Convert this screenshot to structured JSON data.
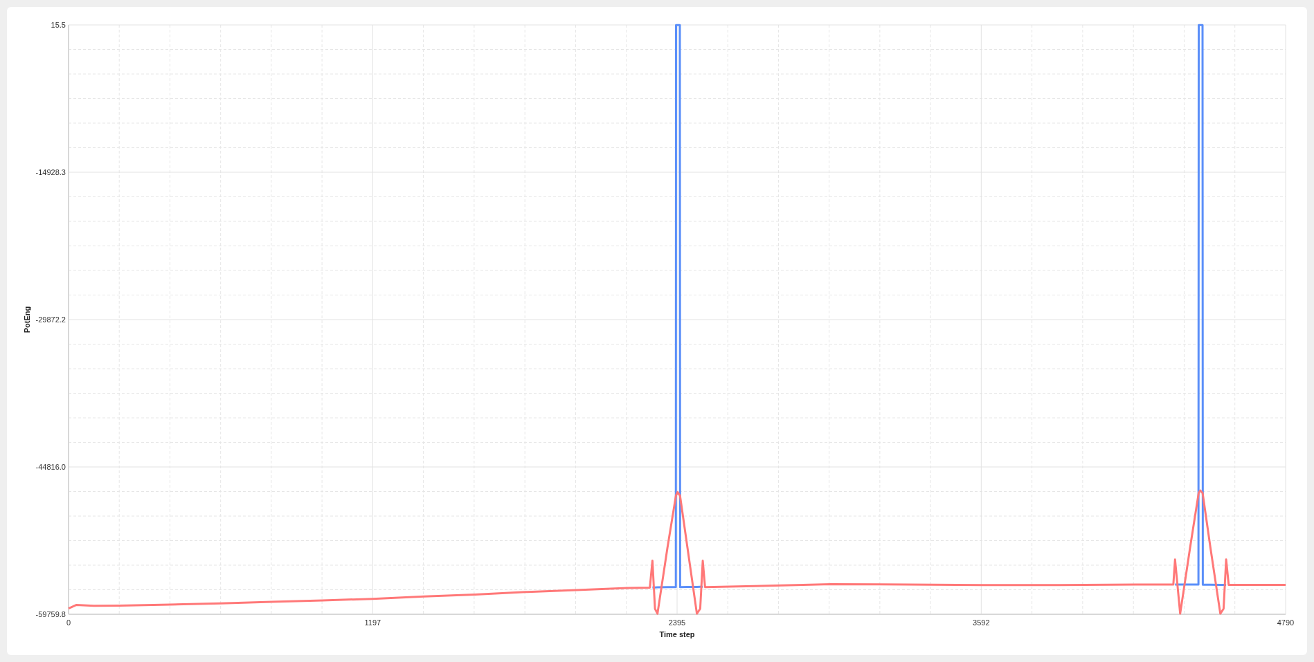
{
  "chart": {
    "chart_data": {
      "type": "line",
      "xlabel": "Time step",
      "ylabel": "PotEng",
      "grid": true,
      "x": [
        0,
        30,
        100,
        200,
        400,
        600,
        800,
        1000,
        1197,
        1400,
        1600,
        1800,
        2000,
        2200,
        2288,
        2298,
        2308,
        2318,
        2357,
        2390,
        2391,
        2397,
        2406,
        2407,
        2436,
        2473,
        2486,
        2496,
        2505,
        2700,
        3000,
        3300,
        3592,
        3900,
        4200,
        4348,
        4355,
        4375,
        4414,
        4447,
        4448,
        4454,
        4463,
        4464,
        4494,
        4533,
        4546,
        4556,
        4566,
        4700,
        4790
      ],
      "series": [
        {
          "color": "#5b8ff9",
          "values": [
            null,
            null,
            null,
            null,
            null,
            null,
            null,
            null,
            null,
            null,
            null,
            null,
            null,
            null,
            null,
            -57040,
            -57040,
            -57030,
            -57010,
            -57000,
            0,
            0,
            0,
            -57000,
            -56990,
            -56980,
            -56975,
            -56970,
            null,
            null,
            null,
            null,
            null,
            null,
            null,
            null,
            -56750,
            -56750,
            -56750,
            -56750,
            0,
            0,
            0,
            -56760,
            -56760,
            -56770,
            -56770,
            -56780,
            null,
            null,
            null
          ]
        },
        {
          "color": "#ff7878",
          "values": [
            -59170,
            -58820,
            -58900,
            -58880,
            -58780,
            -58650,
            -58500,
            -58350,
            -58200,
            -57950,
            -57750,
            -57500,
            -57300,
            -57100,
            -57050,
            -54330,
            -59200,
            -59700,
            -53000,
            -47800,
            -47700,
            -47360,
            -47700,
            -47800,
            -53000,
            -59700,
            -59200,
            -54330,
            -57000,
            -56900,
            -56700,
            -56750,
            -56800,
            -56800,
            -56750,
            -56750,
            -54200,
            -59700,
            -53000,
            -47600,
            -47450,
            -47200,
            -47450,
            -47600,
            -53000,
            -59700,
            -59200,
            -54200,
            -56780,
            -56780,
            -56780
          ]
        }
      ],
      "xlim": [
        0,
        4790
      ],
      "ylim": [
        -59759.8,
        15.5
      ],
      "xticks": [
        0,
        1197,
        2395,
        3592,
        4790
      ],
      "yticks": [
        -59759.8,
        {
          "value": -44816.0,
          "label": "-44816.0"
        },
        -29872.2,
        -14928.3,
        15.5
      ]
    }
  }
}
